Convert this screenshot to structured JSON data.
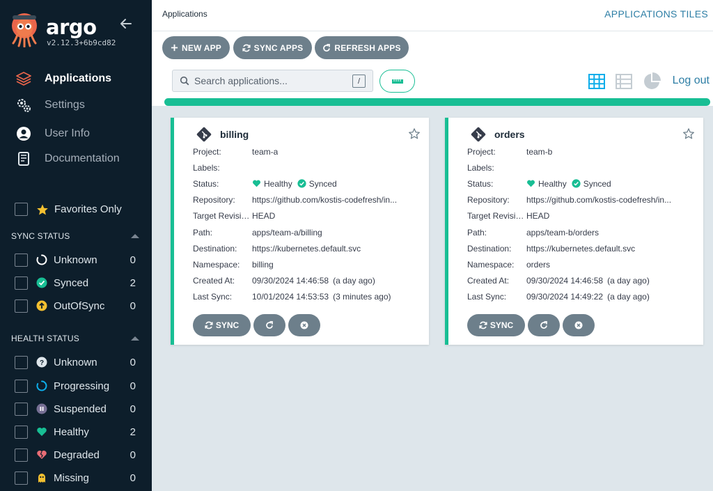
{
  "sidebar": {
    "brand": "argo",
    "version": "v2.12.3+6b9cd82",
    "nav": [
      {
        "label": "Applications",
        "icon": "layers-icon",
        "active": true
      },
      {
        "label": "Settings",
        "icon": "gears-icon"
      },
      {
        "label": "User Info",
        "icon": "user-circle-icon"
      },
      {
        "label": "Documentation",
        "icon": "book-icon"
      }
    ],
    "favorites_label": "Favorites Only",
    "sync_status": {
      "title": "SYNC STATUS",
      "items": [
        {
          "label": "Unknown",
          "count": "0",
          "icon": "circle-notch-icon"
        },
        {
          "label": "Synced",
          "count": "2",
          "icon": "check-circle-icon"
        },
        {
          "label": "OutOfSync",
          "count": "0",
          "icon": "arrow-up-circle-icon"
        }
      ]
    },
    "health_status": {
      "title": "HEALTH STATUS",
      "items": [
        {
          "label": "Unknown",
          "count": "0",
          "icon": "question-circle-icon"
        },
        {
          "label": "Progressing",
          "count": "0",
          "icon": "circle-notch-icon"
        },
        {
          "label": "Suspended",
          "count": "0",
          "icon": "pause-circle-icon"
        },
        {
          "label": "Healthy",
          "count": "2",
          "icon": "heart-icon"
        },
        {
          "label": "Degraded",
          "count": "0",
          "icon": "heart-broken-icon"
        },
        {
          "label": "Missing",
          "count": "0",
          "icon": "ghost-icon"
        }
      ]
    }
  },
  "header": {
    "page_title": "Applications",
    "view_title": "APPLICATIONS TILES"
  },
  "toolbar": {
    "new_app": "NEW APP",
    "sync_apps": "SYNC APPS",
    "refresh_apps": "REFRESH APPS",
    "search_placeholder": "Search applications...",
    "search_shortcut": "/",
    "logout": "Log out"
  },
  "progress": {
    "synced_fraction": 1.0
  },
  "colors": {
    "accent": "#18be94",
    "sidebar_bg": "#0d1e2b",
    "button_bg": "#6d7f8b",
    "link": "#2d7ea5",
    "outofsync": "#f4c030",
    "degraded": "#e96d76",
    "suspended": "#766f94"
  },
  "field_labels": {
    "project": "Project:",
    "labels": "Labels:",
    "status": "Status:",
    "repository": "Repository:",
    "target_revision": "Target Revision:",
    "path": "Path:",
    "destination": "Destination:",
    "namespace": "Namespace:",
    "created_at": "Created At:",
    "last_sync": "Last Sync:"
  },
  "card_actions": {
    "sync": "SYNC"
  },
  "apps": [
    {
      "name": "billing",
      "project": "team-a",
      "labels": "",
      "health": "Healthy",
      "sync": "Synced",
      "repository": "https://github.com/kostis-codefresh/in...",
      "target_revision": "HEAD",
      "path": "apps/team-a/billing",
      "destination": "https://kubernetes.default.svc",
      "namespace": "billing",
      "created_at": "09/30/2024 14:46:58",
      "created_rel": "(a day ago)",
      "last_sync": "10/01/2024 14:53:53",
      "last_sync_rel": "(3 minutes ago)"
    },
    {
      "name": "orders",
      "project": "team-b",
      "labels": "",
      "health": "Healthy",
      "sync": "Synced",
      "repository": "https://github.com/kostis-codefresh/in...",
      "target_revision": "HEAD",
      "path": "apps/team-b/orders",
      "destination": "https://kubernetes.default.svc",
      "namespace": "orders",
      "created_at": "09/30/2024 14:46:58",
      "created_rel": "(a day ago)",
      "last_sync": "09/30/2024 14:49:22",
      "last_sync_rel": "(a day ago)"
    }
  ]
}
